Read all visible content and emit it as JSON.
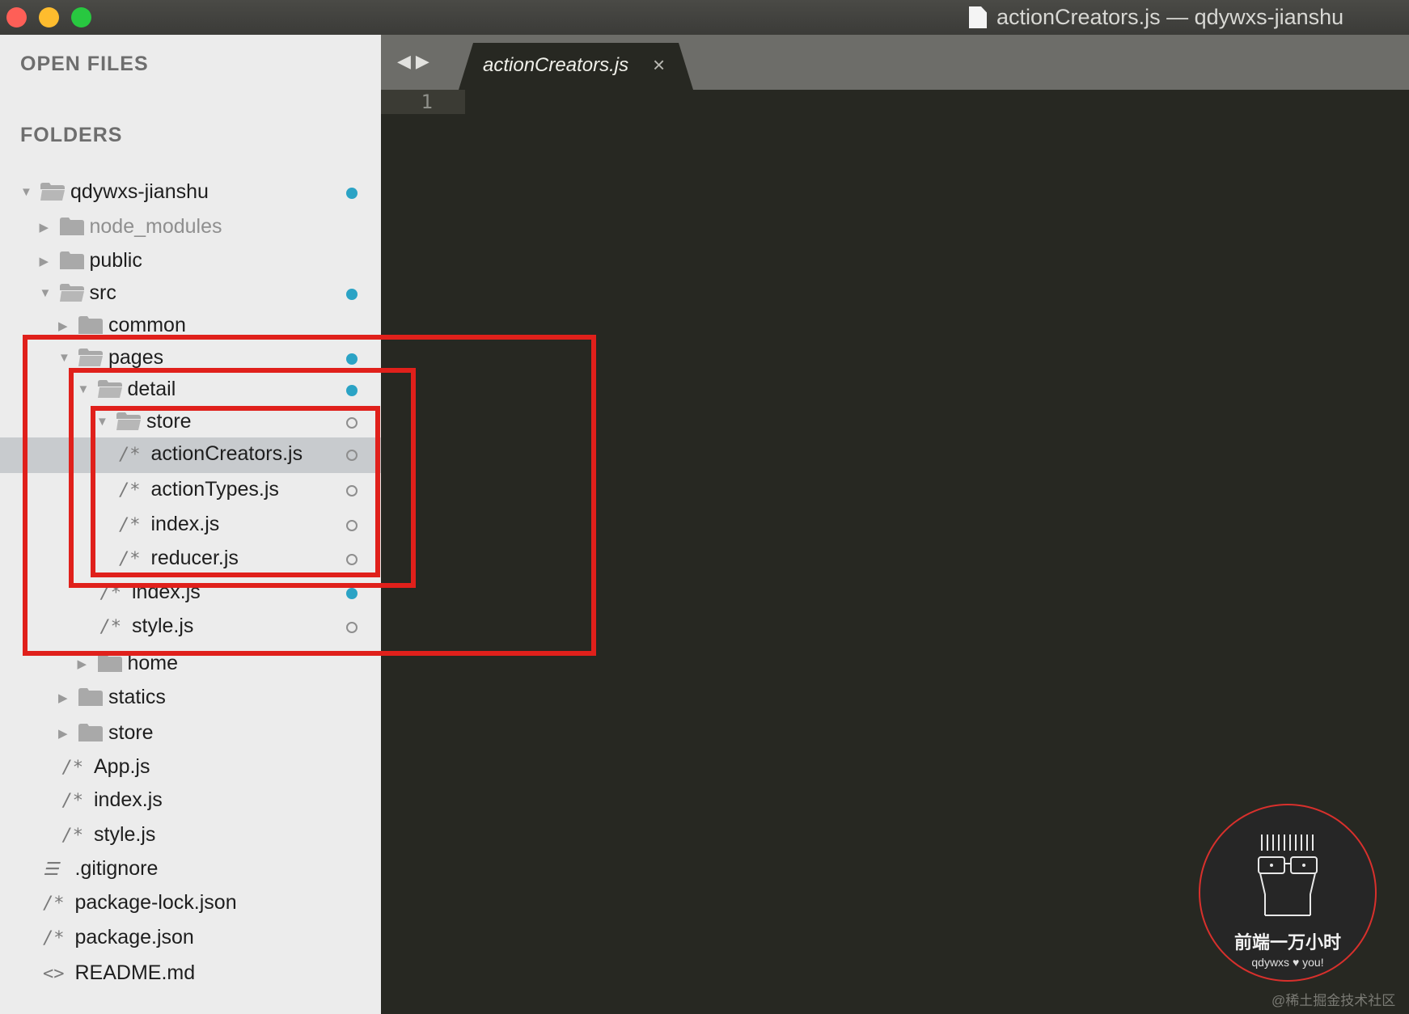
{
  "window": {
    "title": "actionCreators.js — qdywxs-jianshu"
  },
  "sidebar": {
    "open_files_label": "OPEN FILES",
    "folders_label": "FOLDERS",
    "tree": [
      {
        "label": "qdywxs-jianshu",
        "kind": "folder-open",
        "depth": 0,
        "status": "modified"
      },
      {
        "label": "node_modules",
        "kind": "folder",
        "depth": 1,
        "status": "none",
        "dim": true
      },
      {
        "label": "public",
        "kind": "folder",
        "depth": 1,
        "status": "none"
      },
      {
        "label": "src",
        "kind": "folder-open",
        "depth": 1,
        "status": "modified"
      },
      {
        "label": "common",
        "kind": "folder",
        "depth": 2,
        "status": "none"
      },
      {
        "label": "pages",
        "kind": "folder-open",
        "depth": 2,
        "status": "modified"
      },
      {
        "label": "detail",
        "kind": "folder-open",
        "depth": 3,
        "status": "modified"
      },
      {
        "label": "store",
        "kind": "folder-open",
        "depth": 4,
        "status": "untracked"
      },
      {
        "label": "actionCreators.js",
        "kind": "file-js",
        "depth": 5,
        "status": "untracked",
        "selected": true
      },
      {
        "label": "actionTypes.js",
        "kind": "file-js",
        "depth": 5,
        "status": "untracked"
      },
      {
        "label": "index.js",
        "kind": "file-js",
        "depth": 5,
        "status": "untracked"
      },
      {
        "label": "reducer.js",
        "kind": "file-js",
        "depth": 5,
        "status": "untracked"
      },
      {
        "label": "index.js",
        "kind": "file-js",
        "depth": 4,
        "status": "modified"
      },
      {
        "label": "style.js",
        "kind": "file-js",
        "depth": 4,
        "status": "untracked"
      },
      {
        "label": "home",
        "kind": "folder",
        "depth": 3,
        "status": "none"
      },
      {
        "label": "statics",
        "kind": "folder",
        "depth": 2,
        "status": "none"
      },
      {
        "label": "store",
        "kind": "folder",
        "depth": 2,
        "status": "none"
      },
      {
        "label": "App.js",
        "kind": "file-js",
        "depth": 2,
        "status": "none"
      },
      {
        "label": "index.js",
        "kind": "file-js",
        "depth": 2,
        "status": "none"
      },
      {
        "label": "style.js",
        "kind": "file-js",
        "depth": 2,
        "status": "none"
      },
      {
        "label": ".gitignore",
        "kind": "file-text",
        "depth": 1,
        "status": "none"
      },
      {
        "label": "package-lock.json",
        "kind": "file-js",
        "depth": 1,
        "status": "none"
      },
      {
        "label": "package.json",
        "kind": "file-js",
        "depth": 1,
        "status": "none"
      },
      {
        "label": "README.md",
        "kind": "file-md",
        "depth": 1,
        "status": "none"
      }
    ]
  },
  "tabs": [
    {
      "label": "actionCreators.js",
      "close": "×",
      "active": true
    }
  ],
  "nav": {
    "back": "◀",
    "forward": "▶"
  },
  "editor": {
    "line_numbers": [
      "1"
    ]
  },
  "watermark": {
    "badge_title": "前端一万小时",
    "badge_sub": "qdywxs ♥ you!",
    "site": "@稀土掘金技术社区"
  },
  "colors": {
    "editor_bg": "#272822",
    "sidebar_bg": "#ececec",
    "status_modified": "#2ba3c5",
    "annotation_red": "#e0201b"
  },
  "icons": {
    "file_js": "/*",
    "file_text": "☰",
    "file_md": "<>"
  }
}
